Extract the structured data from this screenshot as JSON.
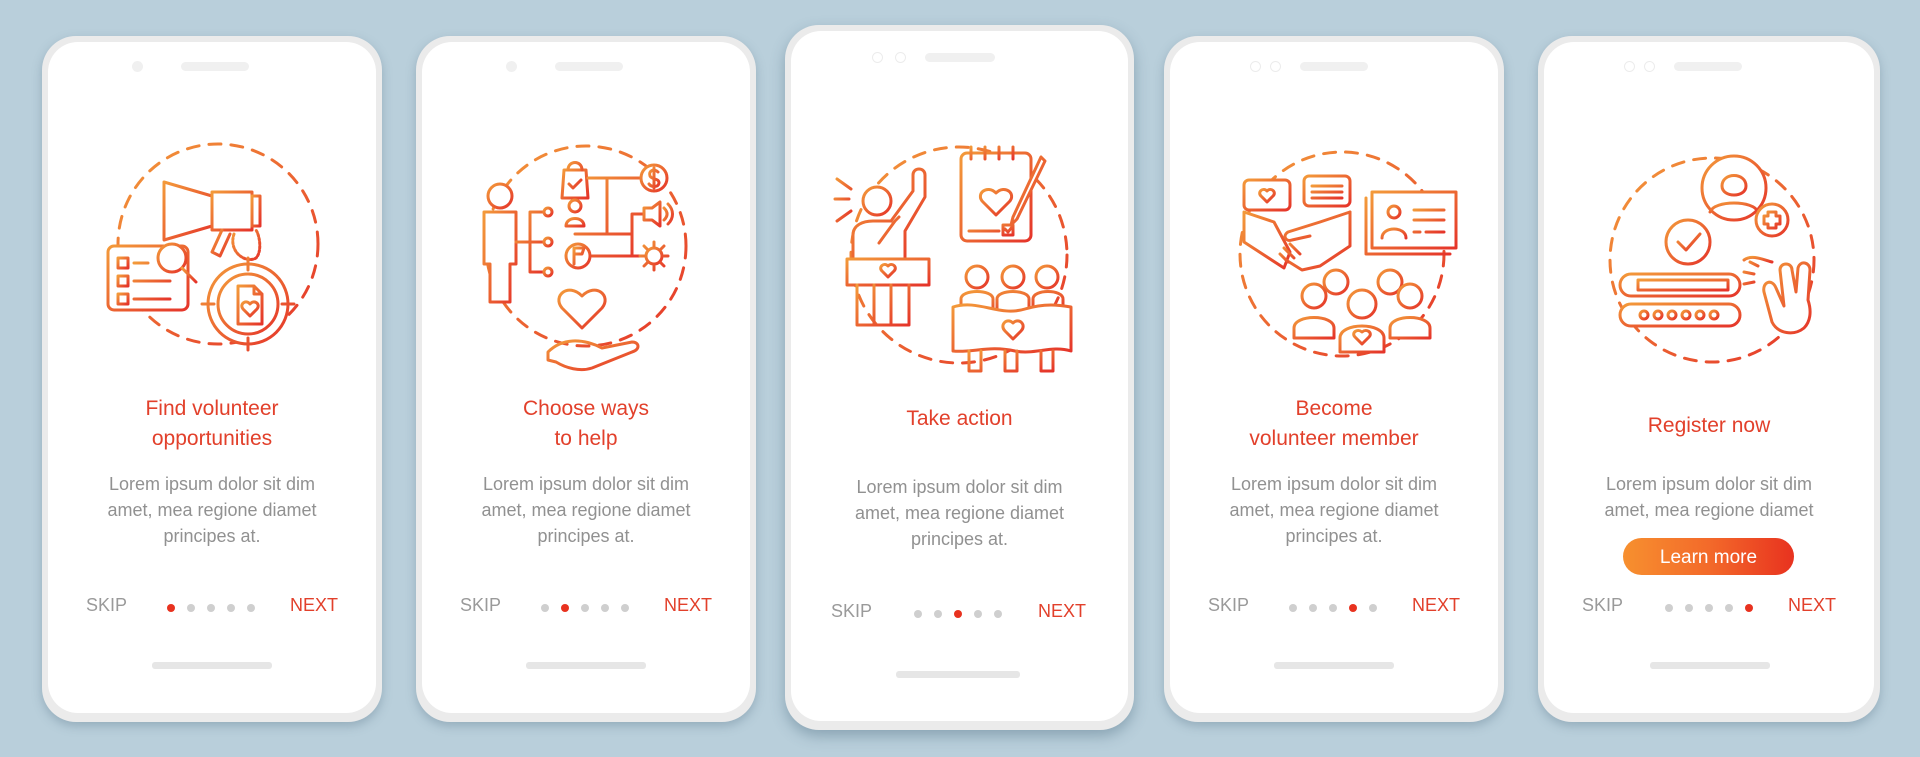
{
  "colors": {
    "background": "#b9cfdb",
    "accent": "#e2402b",
    "gradient_start": "#f7902f",
    "gradient_end": "#e8321f",
    "body_text": "#919191",
    "dot_inactive": "#cfcfcf"
  },
  "screens": [
    {
      "illustration": "megaphone-search-target-icon",
      "title_lines": [
        "Find volunteer",
        "opportunities"
      ],
      "body_lines": [
        "Lorem ipsum dolor sit dim",
        "amet, mea regione diamet",
        "principes at."
      ],
      "skip_label": "SKIP",
      "next_label": "NEXT",
      "active_page": 1,
      "page_count": 5
    },
    {
      "illustration": "person-options-heart-hand-icon",
      "title_lines": [
        "Choose ways",
        "to help"
      ],
      "body_lines": [
        "Lorem ipsum dolor sit dim",
        "amet, mea regione diamet",
        "principes at."
      ],
      "skip_label": "SKIP",
      "next_label": "NEXT",
      "active_page": 2,
      "page_count": 5
    },
    {
      "illustration": "speaker-petition-group-banner-icon",
      "title_lines": [
        "Take action"
      ],
      "body_lines": [
        "Lorem ipsum dolor sit dim",
        "amet, mea regione diamet",
        "principes at."
      ],
      "skip_label": "SKIP",
      "next_label": "NEXT",
      "active_page": 3,
      "page_count": 5
    },
    {
      "illustration": "handshake-idcard-group-icon",
      "title_lines": [
        "Become",
        "volunteer member"
      ],
      "body_lines": [
        "Lorem ipsum dolor sit dim",
        "amet, mea regione diamet",
        "principes at."
      ],
      "skip_label": "SKIP",
      "next_label": "NEXT",
      "active_page": 4,
      "page_count": 5
    },
    {
      "illustration": "register-form-user-add-icon",
      "title_lines": [
        "Register now"
      ],
      "body_lines": [
        "Lorem ipsum dolor sit dim",
        "amet, mea regione diamet"
      ],
      "button_label": "Learn more",
      "skip_label": "SKIP",
      "next_label": "NEXT",
      "active_page": 5,
      "page_count": 5
    }
  ]
}
